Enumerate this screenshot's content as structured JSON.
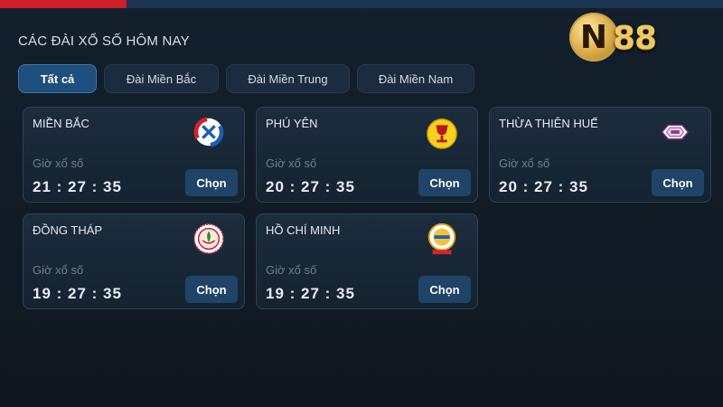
{
  "page": {
    "section_title": "CÁC ĐÀI XỔ SỐ HÔM NAY"
  },
  "brand": {
    "coin_letter": "N",
    "digits": "88"
  },
  "filters": [
    {
      "label": "Tất cả",
      "active": true
    },
    {
      "label": "Đài Miền Bắc",
      "active": false
    },
    {
      "label": "Đài Miền Trung",
      "active": false
    },
    {
      "label": "Đài Miền Nam",
      "active": false
    }
  ],
  "stations": [
    {
      "name": "MIỀN BẮC",
      "time_label": "Giờ xổ số",
      "time": "21 : 27 : 35",
      "button": "Chọn",
      "emblem": "xs-red-blue-logo-icon"
    },
    {
      "name": "PHÚ YÊN",
      "time_label": "Giờ xổ số",
      "time": "20 : 27 : 35",
      "button": "Chọn",
      "emblem": "golden-trophy-emblem-icon"
    },
    {
      "name": "THỪA THIÊN HUẾ",
      "time_label": "Giờ xổ số",
      "time": "20 : 27 : 35",
      "button": "Chọn",
      "emblem": "citadel-gate-emblem-icon"
    },
    {
      "name": "ĐỒNG THÁP",
      "time_label": "Giờ xổ số",
      "time": "19 : 27 : 35",
      "button": "Chọn",
      "emblem": "lotus-seal-emblem-icon"
    },
    {
      "name": "HỒ CHÍ MINH",
      "time_label": "Giờ xổ số",
      "time": "19 : 27 : 35",
      "button": "Chọn",
      "emblem": "city-lottery-emblem-icon"
    }
  ],
  "colors": {
    "accent_red": "#d01f27",
    "active_filter": "#1f4d7c",
    "button_blue": "#1f4468",
    "brand_gold": "#f1c95d"
  }
}
